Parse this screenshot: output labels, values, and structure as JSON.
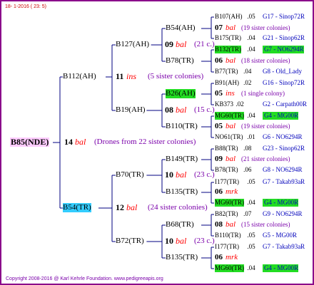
{
  "header": {
    "date": "18-  1-2016 ( 23:  5)"
  },
  "footer": {
    "copyright": "Copyright 2008-2016 @ Karl Kehrle Foundation.   www.pedigreeapis.org"
  },
  "colors": {
    "frame": "#8a0a8a",
    "lines": "#000080",
    "highlight_green": "#22dd22",
    "root_bg": "#ffccff",
    "blue_hl": "#33ccff",
    "red": "#ff0000",
    "blue": "#0000bb"
  },
  "root": {
    "id": "B85(NDE)",
    "gen": "14",
    "race": "bal",
    "note": "(Drones from 22 sister colonies)"
  },
  "g1": {
    "top": {
      "id": "B112(AH)",
      "gen": "11",
      "race": "ins",
      "note": "(5 sister colonies)"
    },
    "bottom": {
      "id": "B54(TR)",
      "gen": "12",
      "race": "bal",
      "note": "(24 sister colonies)"
    }
  },
  "g2": [
    {
      "id": "B127(AH)",
      "gen": "09",
      "race": "bal",
      "note": "(21 c.)"
    },
    {
      "id": "B19(AH)",
      "gen": "08",
      "race": "bal",
      "note": "(15 c.)"
    },
    {
      "id": "B70(TR)",
      "gen": "10",
      "race": "bal",
      "note": "(23 c.)"
    },
    {
      "id": "B72(TR)",
      "gen": "10",
      "race": "bal",
      "note": "(23 c.)"
    }
  ],
  "g3": [
    {
      "id": "B54(AH)",
      "gen": "07",
      "race": "bal",
      "note": "(19 sister colonies)",
      "hl": false
    },
    {
      "id": "B78(TR)",
      "gen": "06",
      "race": "bal",
      "note": "(18 sister colonies)",
      "hl": false
    },
    {
      "id": "B26(AH)",
      "gen": "05",
      "race": "ins",
      "note": "(1 single colony)",
      "hl": true
    },
    {
      "id": "B110(TR)",
      "gen": "05",
      "race": "bal",
      "note": "(19 sister colonies)",
      "hl": false
    },
    {
      "id": "B149(TR)",
      "gen": "09",
      "race": "bal",
      "note": "(21 sister colonies)",
      "hl": false
    },
    {
      "id": "B135(TR)",
      "gen": "06",
      "race": "mrk",
      "note": "",
      "hl": false
    },
    {
      "id": "B68(TR)",
      "gen": "08",
      "race": "bal",
      "note": "(15 sister colonies)",
      "hl": false
    },
    {
      "id": "B135(TR)",
      "gen": "06",
      "race": "mrk",
      "note": "",
      "hl": false
    }
  ],
  "g4": [
    {
      "id": "B107(AH)",
      "year": ".05",
      "ref": "G17 - Sinop72R",
      "hl": false
    },
    {
      "id": "B175(TR)",
      "year": ".04",
      "ref": "G21 - Sinop62R",
      "hl": false
    },
    {
      "id": "B132(TR)",
      "year": ".04",
      "ref": "G7 - NO6294R",
      "hl": true
    },
    {
      "id": "B77(TR)",
      "year": ".04",
      "ref": "G8 - Old_Lady",
      "hl": false
    },
    {
      "id": "B91(AH)",
      "year": ".02",
      "ref": "G16 - Sinop72R",
      "hl": false
    },
    {
      "id": "KB373",
      "year": ".02",
      "ref": "G2 - Carpath00R",
      "hl": false
    },
    {
      "id": "MG60(TR)",
      "year": ".04",
      "ref": "G4 - MG00R",
      "hl": true
    },
    {
      "id": "NO61(TR)",
      "year": ".01",
      "ref": "G6 - NO6294R",
      "hl": false
    },
    {
      "id": "B88(TR)",
      "year": ".08",
      "ref": "G23 - Sinop62R",
      "hl": false
    },
    {
      "id": "B78(TR)",
      "year": ".06",
      "ref": "G8 - NO6294R",
      "hl": false
    },
    {
      "id": "I177(TR)",
      "year": ".05",
      "ref": "G7 - Takab93aR",
      "hl": false
    },
    {
      "id": "MG60(TR)",
      "year": ".04",
      "ref": "G4 - MG00R",
      "hl": true
    },
    {
      "id": "B82(TR)",
      "year": ".07",
      "ref": "G9 - NO6294R",
      "hl": false
    },
    {
      "id": "B110(TR)",
      "year": ".05",
      "ref": "G5 - MG00R",
      "hl": false
    },
    {
      "id": "I177(TR)",
      "year": ".05",
      "ref": "G7 - Takab93aR",
      "hl": false
    },
    {
      "id": "MG60(TR)",
      "year": ".04",
      "ref": "G4 - MG00R",
      "hl": true
    }
  ]
}
